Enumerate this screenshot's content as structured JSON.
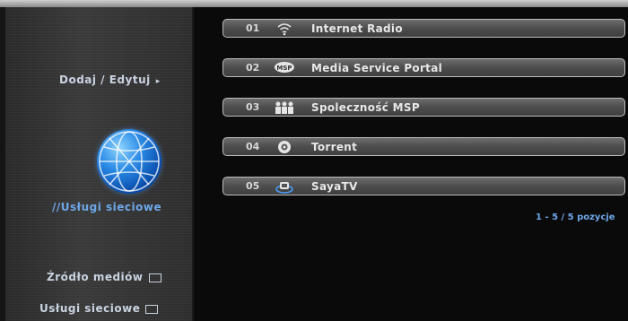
{
  "sidebar": {
    "add_edit_label": "Dodaj / Edytuj",
    "add_edit_arrow": "▸",
    "active_section_label": "//Usługi sieciowe",
    "media_source_label": "Źródło mediów",
    "network_services_label": "Usługi sieciowe"
  },
  "menu": {
    "items": [
      {
        "number": "01",
        "icon": "wifi-icon",
        "label": "Internet Radio"
      },
      {
        "number": "02",
        "icon": "msp-icon",
        "label": "Media Service Portal"
      },
      {
        "number": "03",
        "icon": "community-icon",
        "label": "Spoleczność MSP"
      },
      {
        "number": "04",
        "icon": "torrent-icon",
        "label": "Torrent"
      },
      {
        "number": "05",
        "icon": "sayatv-icon",
        "label": "SayaTV"
      }
    ],
    "range": "1 - 5 / 5 pozycje"
  },
  "colors": {
    "accent_blue": "#6ea7e8",
    "text_light": "#c9d3e0",
    "item_border": "#bdbdbd"
  }
}
